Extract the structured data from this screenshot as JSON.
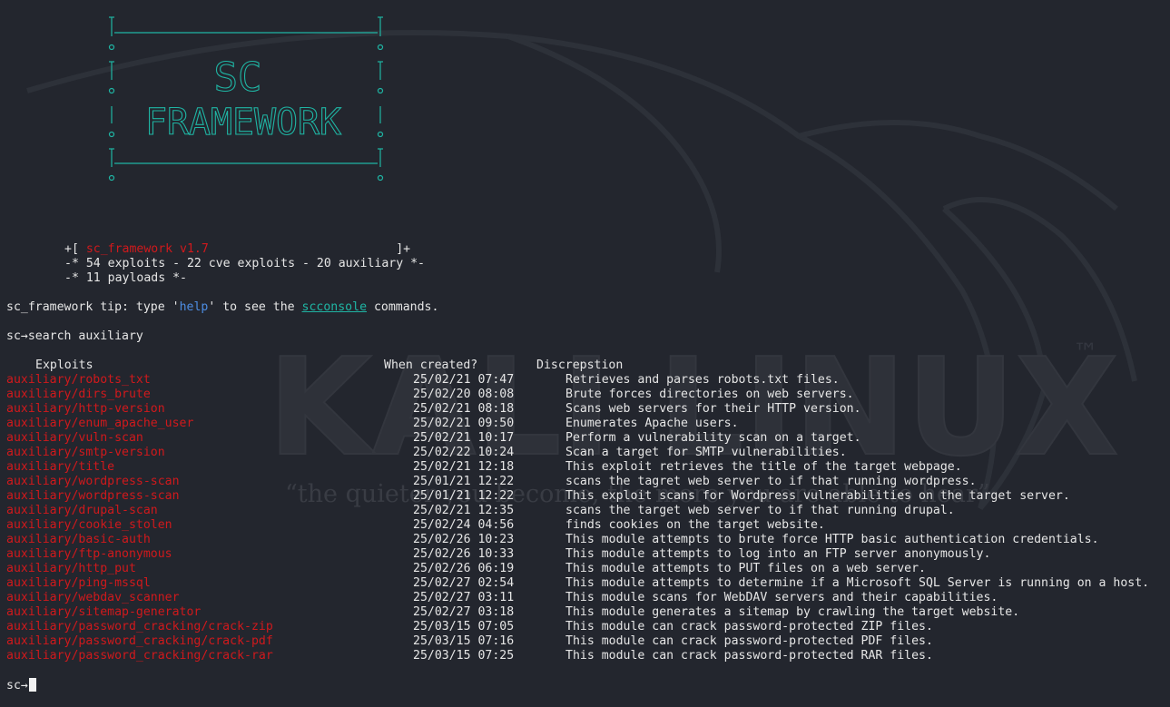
{
  "banner": {
    "line1": "SC",
    "line2": "FRAMEWORK"
  },
  "info": {
    "version_prefix": "+[ ",
    "version": "sc_framework v1.7",
    "version_suffix": "                          ]+",
    "stats": "-* 54 exploits - 22 cve exploits - 20 auxiliary *-",
    "payloads": "-* 11 payloads *-"
  },
  "tip": {
    "prefix": "sc_framework tip: type '",
    "help": "help",
    "middle": "' to see the ",
    "console": "scconsole",
    "suffix": " commands."
  },
  "prompt": "sc",
  "prompt_arrow": "→",
  "command": "search auxiliary",
  "table": {
    "headers": [
      "Exploits",
      "When created?",
      "Discrepstion"
    ],
    "rows": [
      {
        "name": "auxiliary/robots_txt",
        "date": "25/02/21 07:47",
        "desc": "Retrieves and parses robots.txt files."
      },
      {
        "name": "auxiliary/dirs_brute",
        "date": "25/02/20 08:08",
        "desc": "Brute forces directories on web servers."
      },
      {
        "name": "auxiliary/http-version",
        "date": "25/02/21 08:18",
        "desc": "Scans web servers for their HTTP version."
      },
      {
        "name": "auxiliary/enum_apache_user",
        "date": "25/02/21 09:50",
        "desc": "Enumerates Apache users."
      },
      {
        "name": "auxiliary/vuln-scan",
        "date": "25/02/21 10:17",
        "desc": "Perform a vulnerability scan on a target."
      },
      {
        "name": "auxiliary/smtp-version",
        "date": "25/02/22 10:24",
        "desc": "Scan a target for SMTP vulnerabilities."
      },
      {
        "name": "auxiliary/title",
        "date": "25/02/21 12:18",
        "desc": "This exploit retrieves the title of the target webpage."
      },
      {
        "name": "auxiliary/wordpress-scan",
        "date": "25/01/21 12:22",
        "desc": "scans the tagret web server to if that running wordpress."
      },
      {
        "name": "auxiliary/wordpress-scan",
        "date": "25/01/21 12:22",
        "desc": "This exploit scans for Wordpress vulnerabilities on the target server."
      },
      {
        "name": "auxiliary/drupal-scan",
        "date": "25/02/21 12:35",
        "desc": "scans the target web server to if that running drupal."
      },
      {
        "name": "auxiliary/cookie_stolen",
        "date": "25/02/24 04:56",
        "desc": "finds cookies on the target website."
      },
      {
        "name": "auxiliary/basic-auth",
        "date": "25/02/26 10:23",
        "desc": "This module attempts to brute force HTTP basic authentication credentials."
      },
      {
        "name": "auxiliary/ftp-anonymous",
        "date": "25/02/26 10:33",
        "desc": "This module attempts to log into an FTP server anonymously."
      },
      {
        "name": "auxiliary/http_put",
        "date": "25/02/26 06:19",
        "desc": "This module attempts to PUT files on a web server."
      },
      {
        "name": "auxiliary/ping-mssql",
        "date": "25/02/27 02:54",
        "desc": "This module attempts to determine if a Microsoft SQL Server is running on a host."
      },
      {
        "name": "auxiliary/webdav_scanner",
        "date": "25/02/27 03:11",
        "desc": "This module scans for WebDAV servers and their capabilities."
      },
      {
        "name": "auxiliary/sitemap-generator",
        "date": "25/02/27 03:18",
        "desc": "This module generates a sitemap by crawling the target website."
      },
      {
        "name": "auxiliary/password_cracking/crack-zip",
        "date": "25/03/15 07:05",
        "desc": "This module can crack password-protected ZIP files."
      },
      {
        "name": "auxiliary/password_cracking/crack-pdf",
        "date": "25/03/15 07:16",
        "desc": "This module can crack password-protected PDF files."
      },
      {
        "name": "auxiliary/password_cracking/crack-rar",
        "date": "25/03/15 07:25",
        "desc": "This module can crack password-protected RAR files."
      }
    ]
  },
  "wallpaper": {
    "logo_text": "KALI LINUX",
    "tm": "™",
    "slogan": "“the quieter you become, the more you are able to hear”"
  },
  "colors": {
    "background": "#23262e",
    "exploit_name": "#d0191c",
    "banner": "#1fb5a4",
    "help": "#4d8de3"
  }
}
